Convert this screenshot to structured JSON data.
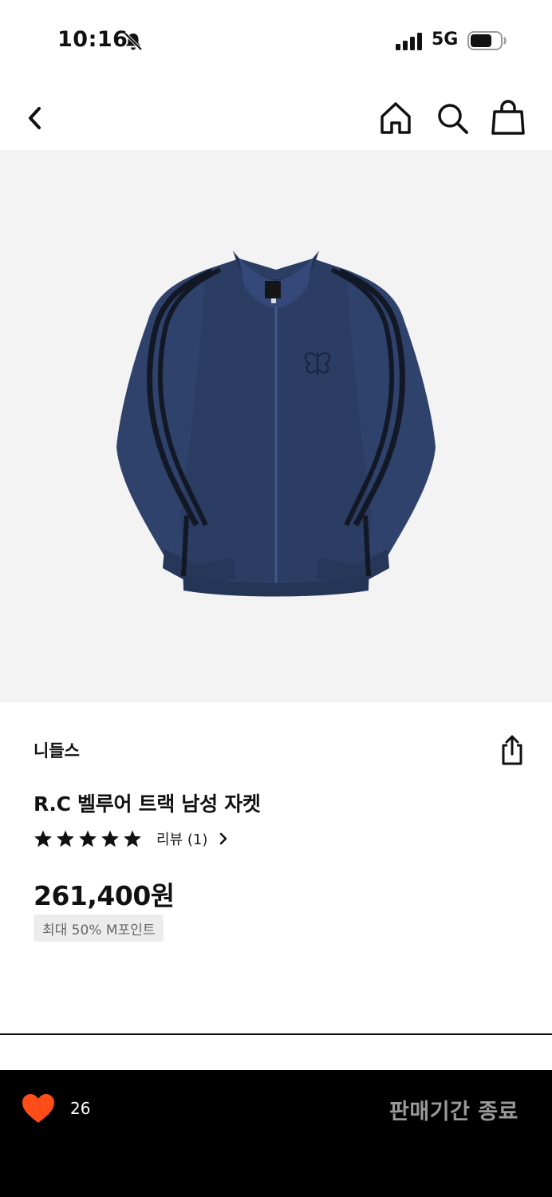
{
  "status_bar": {
    "time": "10:16",
    "network": "5G",
    "icons": [
      "bell-slash-icon",
      "signal-icon",
      "battery-icon"
    ]
  },
  "nav": {
    "icons": [
      "chevron-left-icon",
      "home-icon",
      "search-icon",
      "shopping-bag-icon"
    ]
  },
  "product": {
    "image": "navy velour track jacket with black side stripes",
    "brand": "니들스",
    "title": "R.C 벨루어 트랙 남성 자켓",
    "rating_stars": 5,
    "review_label": "리뷰 (1)",
    "price": "261,400원",
    "points_badge": "최대 50% M포인트"
  },
  "bottom_bar": {
    "like_count": "26",
    "like_color": "#ff4d1a",
    "sale_status": "판매기간 종료"
  },
  "colors": {
    "jacket": "#2b3d63",
    "stripe": "#121826",
    "image_bg": "#f3f3f3",
    "bottom_bar_bg": "#000000"
  }
}
